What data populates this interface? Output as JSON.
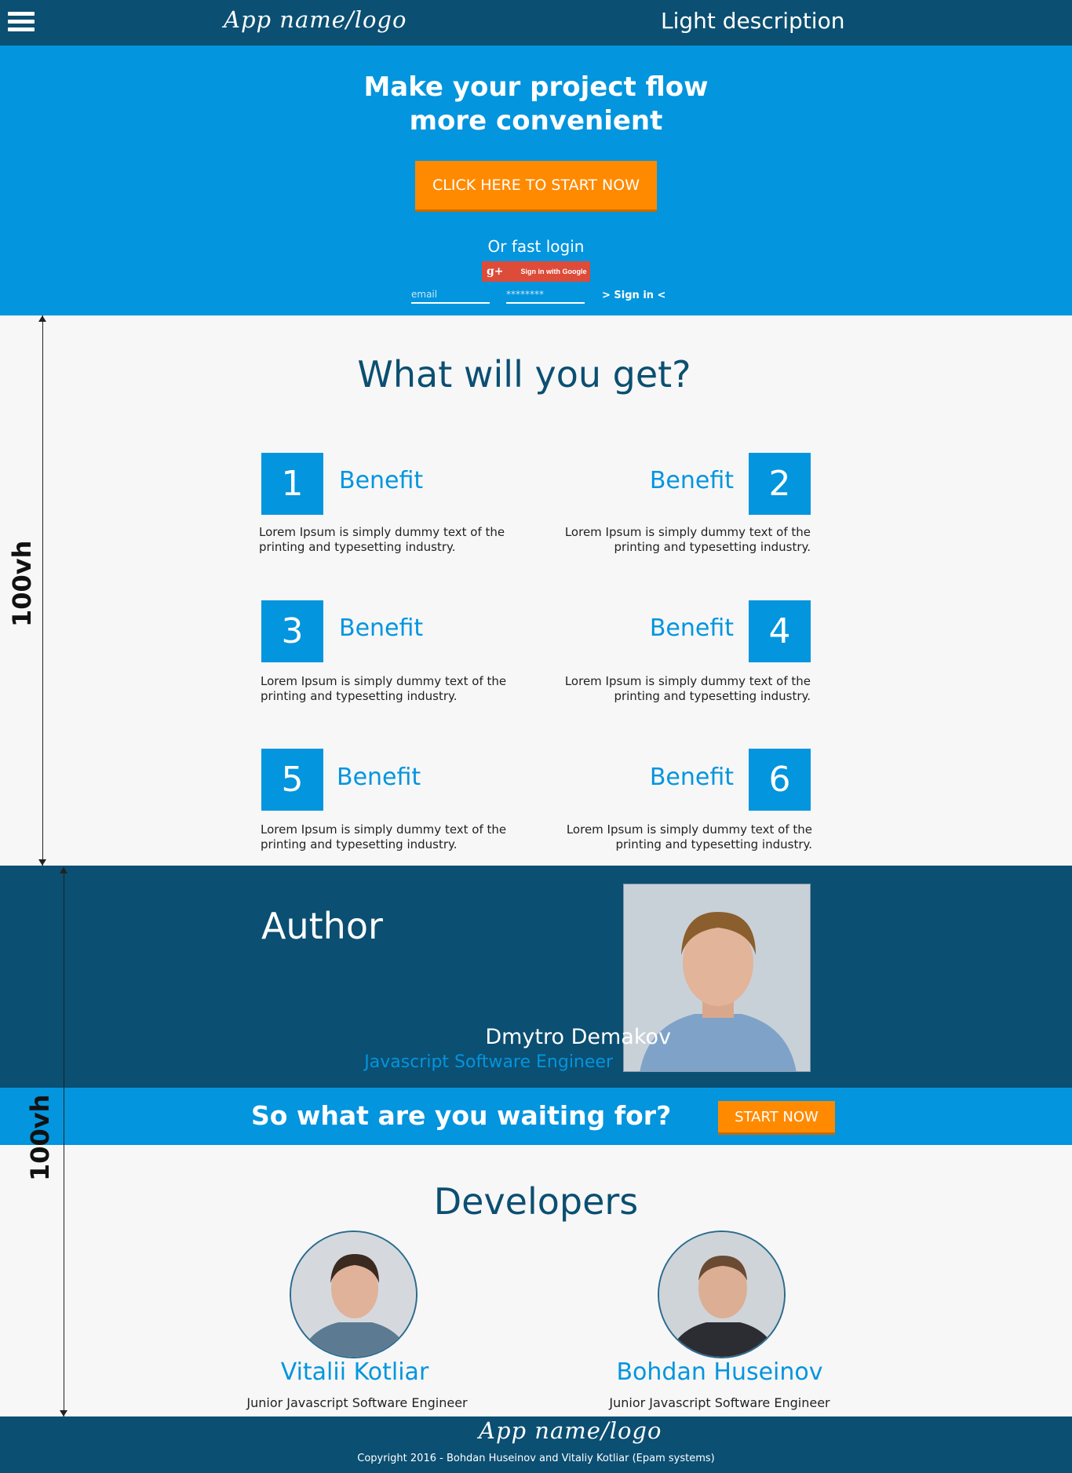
{
  "header": {
    "logo": "App name/logo",
    "description": "Light description"
  },
  "hero": {
    "title_line1": "Make your project flow",
    "title_line2": "more convenient",
    "cta_label": "CLICK HERE TO START NOW",
    "fast_login_label": "Or fast login",
    "google_label": "Sign in with Google",
    "google_icon": "g+",
    "email_placeholder": "email",
    "password_placeholder": "********",
    "signin_label": "> Sign in <"
  },
  "benefits": {
    "title": "What will you get?",
    "items": [
      {
        "number": "1",
        "title": "Benefit",
        "text": "Lorem Ipsum is simply dummy text of the printing and typesetting industry."
      },
      {
        "number": "2",
        "title": "Benefit",
        "text": "Lorem Ipsum is simply dummy text of the printing and typesetting industry."
      },
      {
        "number": "3",
        "title": "Benefit",
        "text": "Lorem Ipsum is simply dummy text of the printing and typesetting industry."
      },
      {
        "number": "4",
        "title": "Benefit",
        "text": "Lorem Ipsum is simply dummy text of the printing and typesetting industry."
      },
      {
        "number": "5",
        "title": "Benefit",
        "text": "Lorem Ipsum is simply dummy text of the printing and typesetting industry."
      },
      {
        "number": "6",
        "title": "Benefit",
        "text": "Lorem Ipsum is simply dummy text of the printing and typesetting industry."
      }
    ]
  },
  "annotations": {
    "height_label_1": "100vh",
    "height_label_2": "100vh"
  },
  "author": {
    "title": "Author",
    "name": "Dmytro Demakov",
    "role": "Javascript Software Engineer"
  },
  "waiting": {
    "text": "So what are you waiting for?",
    "button_label": "START NOW"
  },
  "developers": {
    "title": "Developers",
    "people": [
      {
        "name": "Vitalii Kotliar",
        "role": "Junior Javascript Software Engineer"
      },
      {
        "name": "Bohdan Huseinov",
        "role": "Junior Javascript Software Engineer"
      }
    ]
  },
  "footer": {
    "logo": "App name/logo",
    "copyright": "Copyright 2016 - Bohdan Huseinov and Vitaliy Kotliar (Epam systems)"
  },
  "colors": {
    "dark_blue": "#0b4f72",
    "bright_blue": "#0395de",
    "orange": "#ff8a00",
    "background": "#f7f7f7"
  }
}
